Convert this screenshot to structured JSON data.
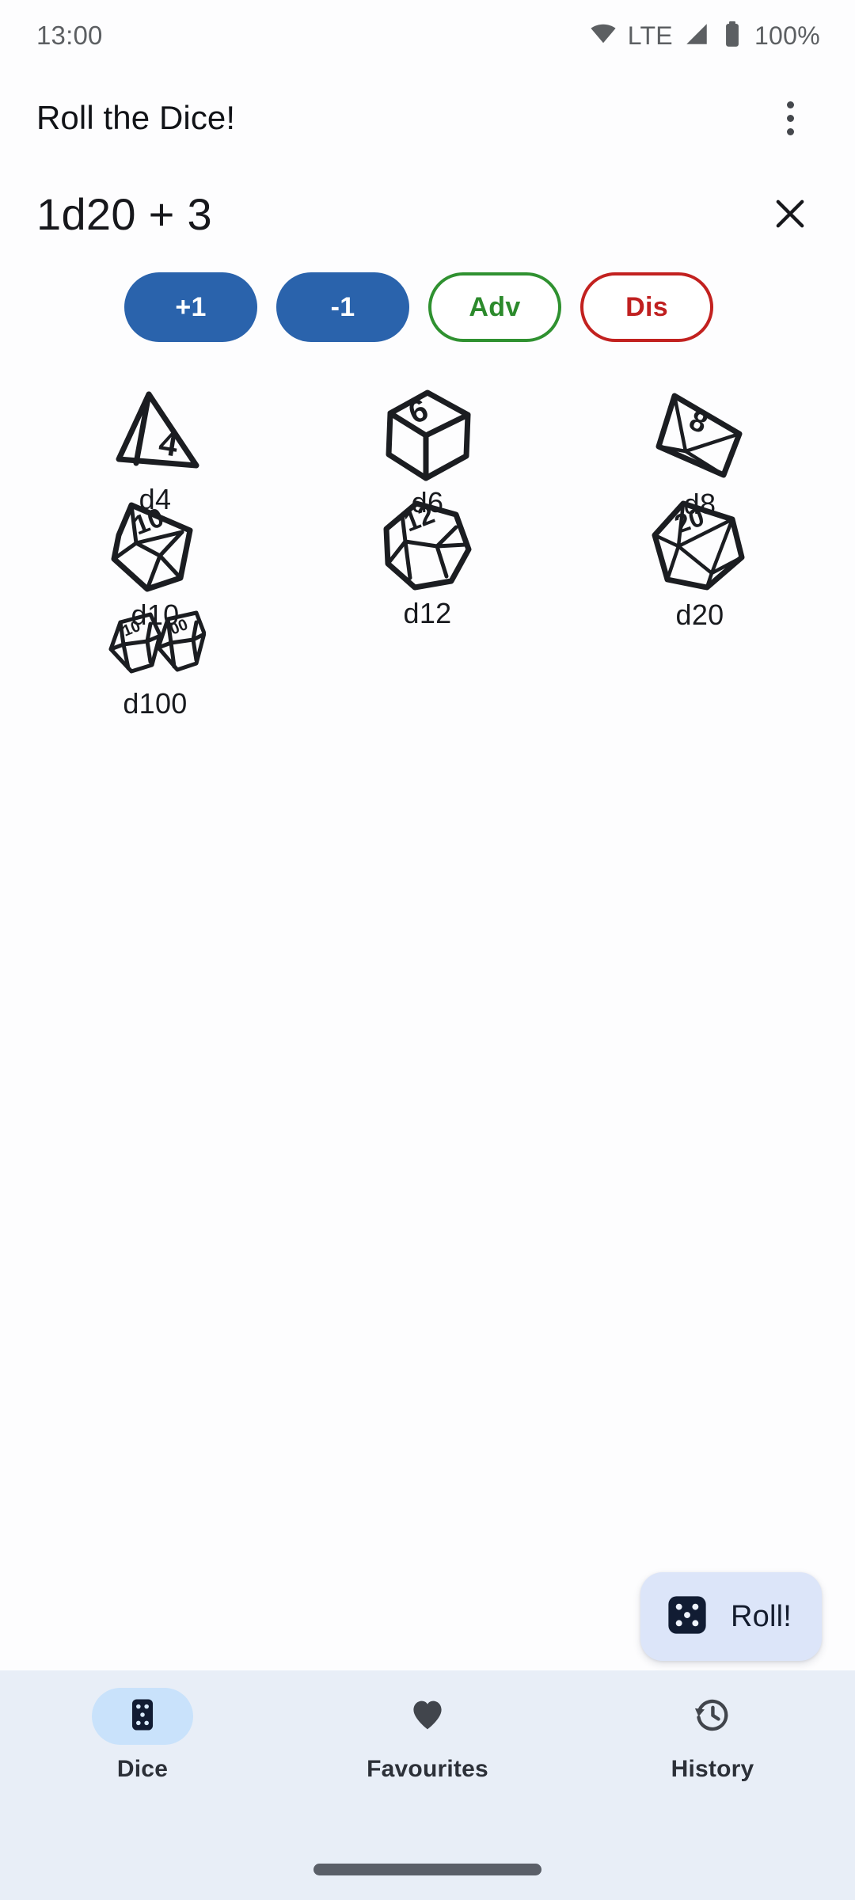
{
  "status_bar": {
    "clock": "13:00",
    "network_label": "LTE",
    "battery_label": "100%",
    "icons": [
      "wifi-icon",
      "cellular-signal-icon",
      "battery-full-icon"
    ]
  },
  "app_bar": {
    "title": "Roll the Dice!",
    "overflow_icon": "more-vert-icon"
  },
  "formula": {
    "expression": "1d20 + 3",
    "clear_icon": "close-icon"
  },
  "modifiers": [
    {
      "label": "+1",
      "style": "filled",
      "name": "increment-modifier"
    },
    {
      "label": "-1",
      "style": "filled",
      "name": "decrement-modifier"
    },
    {
      "label": "Adv",
      "style": "outline-green",
      "name": "advantage"
    },
    {
      "label": "Dis",
      "style": "outline-red",
      "name": "disadvantage"
    }
  ],
  "dice": [
    {
      "label": "d4",
      "icon": "d4-tetrahedron-icon",
      "face": "4"
    },
    {
      "label": "d6",
      "icon": "d6-cube-icon",
      "face": "6"
    },
    {
      "label": "d8",
      "icon": "d8-octahedron-icon",
      "face": "8"
    },
    {
      "label": "d10",
      "icon": "d10-pentagonal-icon",
      "face": "10"
    },
    {
      "label": "d12",
      "icon": "d12-dodecahedron-icon",
      "face": "12"
    },
    {
      "label": "d20",
      "icon": "d20-icosahedron-icon",
      "face": "20"
    },
    {
      "label": "d100",
      "icon": "d100-percentile-icon",
      "face": "10 00"
    }
  ],
  "roll_button": {
    "label": "Roll!",
    "icon": "dice-five-icon"
  },
  "bottom_nav": {
    "items": [
      {
        "label": "Dice",
        "icon": "dice-icon",
        "active": true
      },
      {
        "label": "Favourites",
        "icon": "heart-icon",
        "active": false
      },
      {
        "label": "History",
        "icon": "history-icon",
        "active": false
      }
    ]
  },
  "colors": {
    "accent_blue": "#2a63ac",
    "advantage_green": "#2f9130",
    "disadvantage_red": "#c2211f",
    "fab_background": "#dce5f9",
    "nav_background": "#e8eef7",
    "nav_active_pill": "#c9e2fb",
    "page_background": "#fdfdfe"
  }
}
